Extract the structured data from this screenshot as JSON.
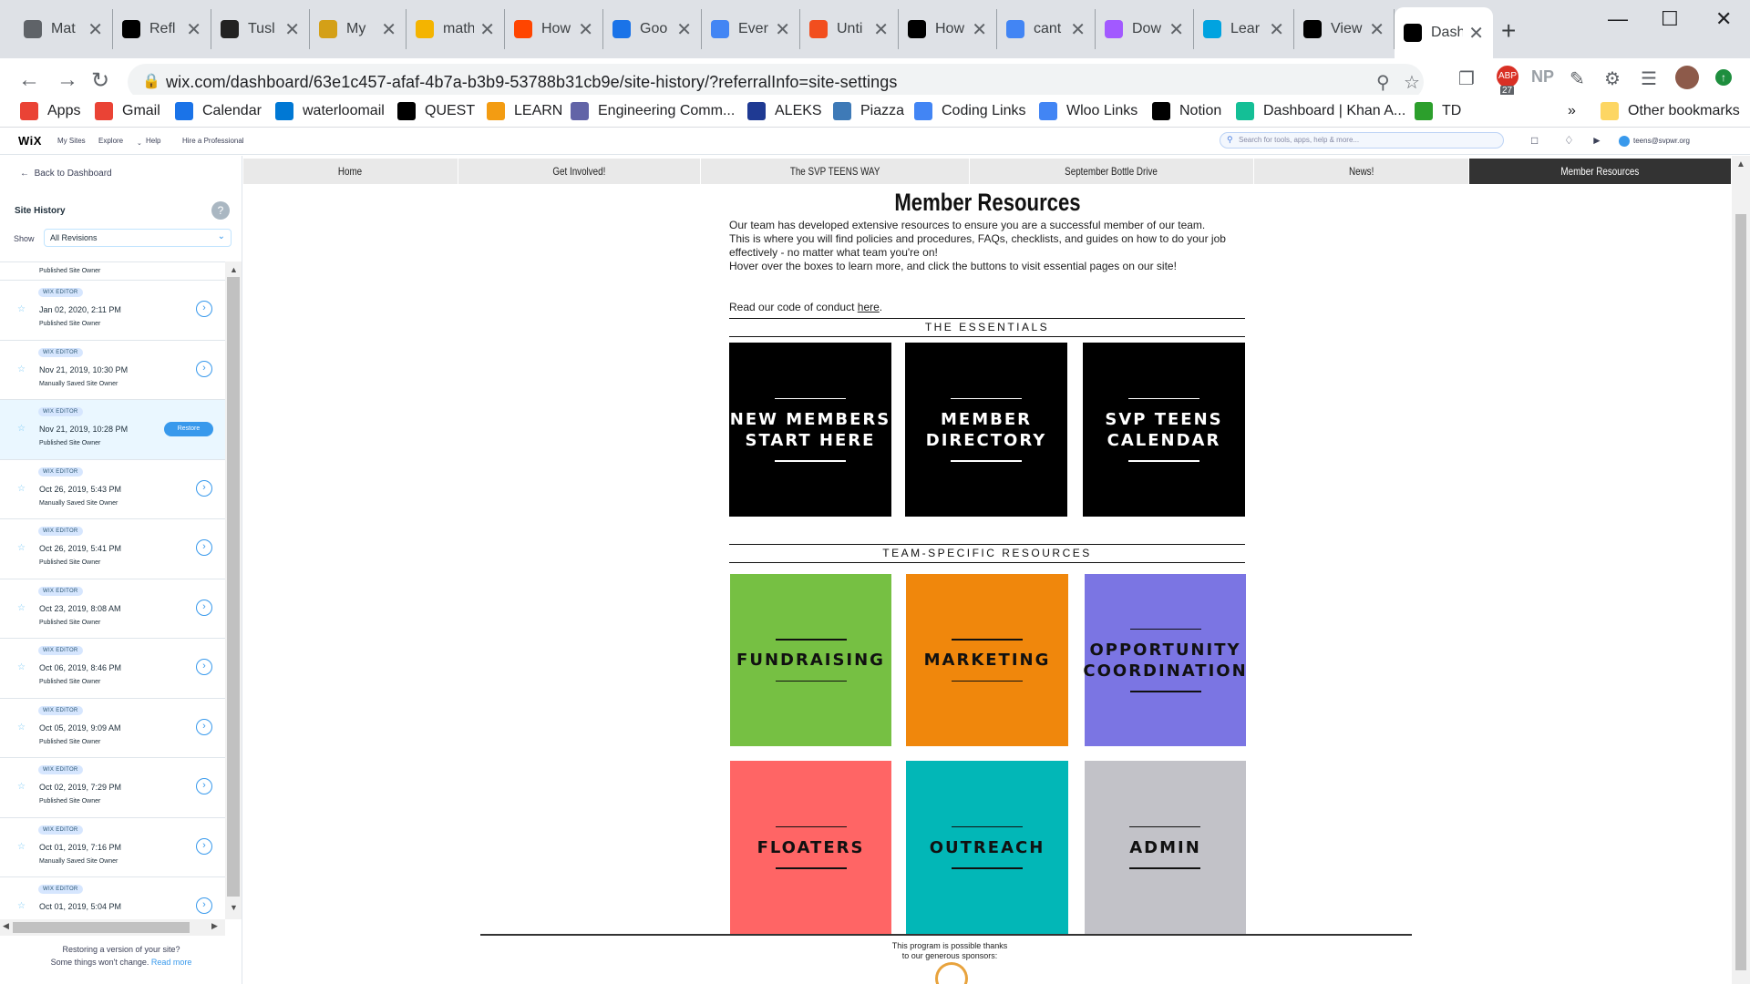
{
  "browser": {
    "tabs": [
      {
        "title": "Mat",
        "icon": "globe-icon",
        "color": "#5f6368"
      },
      {
        "title": "Refl",
        "icon": "medium-icon",
        "color": "#000000"
      },
      {
        "title": "Tusl",
        "icon": "tusl-icon",
        "color": "#222222"
      },
      {
        "title": "My",
        "icon": "folder-icon",
        "color": "#d4a017"
      },
      {
        "title": "math",
        "icon": "emoji-icon",
        "color": "#f4b400"
      },
      {
        "title": "How",
        "icon": "reddit-icon",
        "color": "#ff4500"
      },
      {
        "title": "Goo",
        "icon": "calendar-icon",
        "color": "#1a73e8"
      },
      {
        "title": "Ever",
        "icon": "docs-icon",
        "color": "#4285f4"
      },
      {
        "title": "Unti",
        "icon": "figma-icon",
        "color": "#f24e1e"
      },
      {
        "title": "How",
        "icon": "circle-icon",
        "color": "#000000"
      },
      {
        "title": "cant",
        "icon": "google-icon",
        "color": "#4285f4"
      },
      {
        "title": "Dow",
        "icon": "figma-icon",
        "color": "#a259ff"
      },
      {
        "title": "Lear",
        "icon": "learn-icon",
        "color": "#00a3e0"
      },
      {
        "title": "View",
        "icon": "wix-icon",
        "color": "#000000"
      },
      {
        "title": "Dash",
        "icon": "wix-icon",
        "color": "#000000"
      }
    ],
    "url": "wix.com/dashboard/63e1c457-afaf-4b7a-b3b9-53788b31cb9e/site-history/?referralInfo=site-settings",
    "extension_badge": "27",
    "extension_np": "NP",
    "bookmarks": [
      {
        "label": "Apps",
        "icon": "apps-icon",
        "color": "#ea4335"
      },
      {
        "label": "Gmail",
        "icon": "gmail-icon",
        "color": "#ea4335"
      },
      {
        "label": "Calendar",
        "icon": "calendar-icon",
        "color": "#1a73e8"
      },
      {
        "label": "waterloomail",
        "icon": "outlook-icon",
        "color": "#0078d4"
      },
      {
        "label": "QUEST",
        "icon": "quest-icon",
        "color": "#000000"
      },
      {
        "label": "LEARN",
        "icon": "learn-icon",
        "color": "#f39c12"
      },
      {
        "label": "Engineering Comm...",
        "icon": "teams-icon",
        "color": "#6264a7"
      },
      {
        "label": "ALEKS",
        "icon": "aleks-icon",
        "color": "#1f3a93"
      },
      {
        "label": "Piazza",
        "icon": "piazza-icon",
        "color": "#3e7ab7"
      },
      {
        "label": "Coding Links",
        "icon": "doc-icon",
        "color": "#4285f4"
      },
      {
        "label": "Wloo Links",
        "icon": "doc-icon",
        "color": "#4285f4"
      },
      {
        "label": "Notion",
        "icon": "notion-icon",
        "color": "#000000"
      },
      {
        "label": "Dashboard | Khan A...",
        "icon": "khan-icon",
        "color": "#14bf96"
      },
      {
        "label": "TD",
        "icon": "td-icon",
        "color": "#2c9f2c"
      }
    ],
    "other_bookmarks": "Other bookmarks",
    "more_bookmarks": "»"
  },
  "wix_topbar": {
    "logo": "WiX",
    "menu": [
      "My Sites",
      "Explore",
      "Help",
      "Hire a Professional"
    ],
    "search_placeholder": "Search for tools, apps, help & more...",
    "account": "teens@svpwr.org"
  },
  "sidebar": {
    "back": "Back to Dashboard",
    "title": "Site History",
    "help": "?",
    "show_label": "Show",
    "show_value": "All Revisions",
    "first_partial": "Published Site Owner",
    "revisions": [
      {
        "badge": "WIX EDITOR",
        "date": "Jan 02, 2020, 2:11 PM",
        "who": "Published Site Owner",
        "selected": false
      },
      {
        "badge": "WIX EDITOR",
        "date": "Nov 21, 2019, 10:30 PM",
        "who": "Manually Saved Site Owner",
        "selected": false
      },
      {
        "badge": "WIX EDITOR",
        "date": "Nov 21, 2019, 10:28 PM",
        "who": "Published Site Owner",
        "selected": true
      },
      {
        "badge": "WIX EDITOR",
        "date": "Oct 26, 2019, 5:43 PM",
        "who": "Manually Saved Site Owner",
        "selected": false
      },
      {
        "badge": "WIX EDITOR",
        "date": "Oct 26, 2019, 5:41 PM",
        "who": "Published Site Owner",
        "selected": false
      },
      {
        "badge": "WIX EDITOR",
        "date": "Oct 23, 2019, 8:08 AM",
        "who": "Published Site Owner",
        "selected": false
      },
      {
        "badge": "WIX EDITOR",
        "date": "Oct 06, 2019, 8:46 PM",
        "who": "Published Site Owner",
        "selected": false
      },
      {
        "badge": "WIX EDITOR",
        "date": "Oct 05, 2019, 9:09 AM",
        "who": "Published Site Owner",
        "selected": false
      },
      {
        "badge": "WIX EDITOR",
        "date": "Oct 02, 2019, 7:29 PM",
        "who": "Published Site Owner",
        "selected": false
      },
      {
        "badge": "WIX EDITOR",
        "date": "Oct 01, 2019, 7:16 PM",
        "who": "Manually Saved Site Owner",
        "selected": false
      },
      {
        "badge": "WIX EDITOR",
        "date": "Oct 01, 2019, 5:04 PM",
        "who": "",
        "selected": false
      }
    ],
    "restore_button": "Restore",
    "note_line1": "Restoring a version of your site?",
    "note_line2": "Some things won't change.",
    "note_link": "Read more"
  },
  "site": {
    "nav": [
      "Home",
      "Get Involved!",
      "The SVP TEENS WAY",
      "September Bottle Drive",
      "News!",
      "Member Resources"
    ],
    "active_nav": "Member Resources",
    "title": "Member Resources",
    "intro": [
      "Our team has developed extensive resources to ensure you are a successful member of our team.",
      "This is where you will find policies and procedures, FAQs, checklists, and guides on how to do your job",
      "effectively - no matter what team you're on!",
      "Hover over the boxes to learn more, and click the buttons to visit essential pages on our site!"
    ],
    "code_prefix": "Read our code of conduct ",
    "code_link": "here",
    "code_suffix": ".",
    "essentials_heading": "THE ESSENTIALS",
    "essentials": [
      {
        "line1": "NEW MEMBERS",
        "line2": "START HERE"
      },
      {
        "line1": "MEMBER",
        "line2": "DIRECTORY"
      },
      {
        "line1": "SVP TEENS",
        "line2": "CALENDAR"
      }
    ],
    "team_heading": "TEAM-SPECIFIC RESOURCES",
    "teams": [
      {
        "line1": "FUNDRAISING",
        "line2": "",
        "color": "#76c043"
      },
      {
        "line1": "MARKETING",
        "line2": "",
        "color": "#f0870c"
      },
      {
        "line1": "OPPORTUNITY",
        "line2": "COORDINATION",
        "color": "#7b75e3"
      },
      {
        "line1": "FLOATERS",
        "line2": "",
        "color": "#ff6565"
      },
      {
        "line1": "OUTREACH",
        "line2": "",
        "color": "#02b7b7"
      },
      {
        "line1": "ADMIN",
        "line2": "",
        "color": "#c2c2c8"
      }
    ],
    "sponsor_line1": "This program is possible thanks",
    "sponsor_line2": "to our generous sponsors:"
  }
}
